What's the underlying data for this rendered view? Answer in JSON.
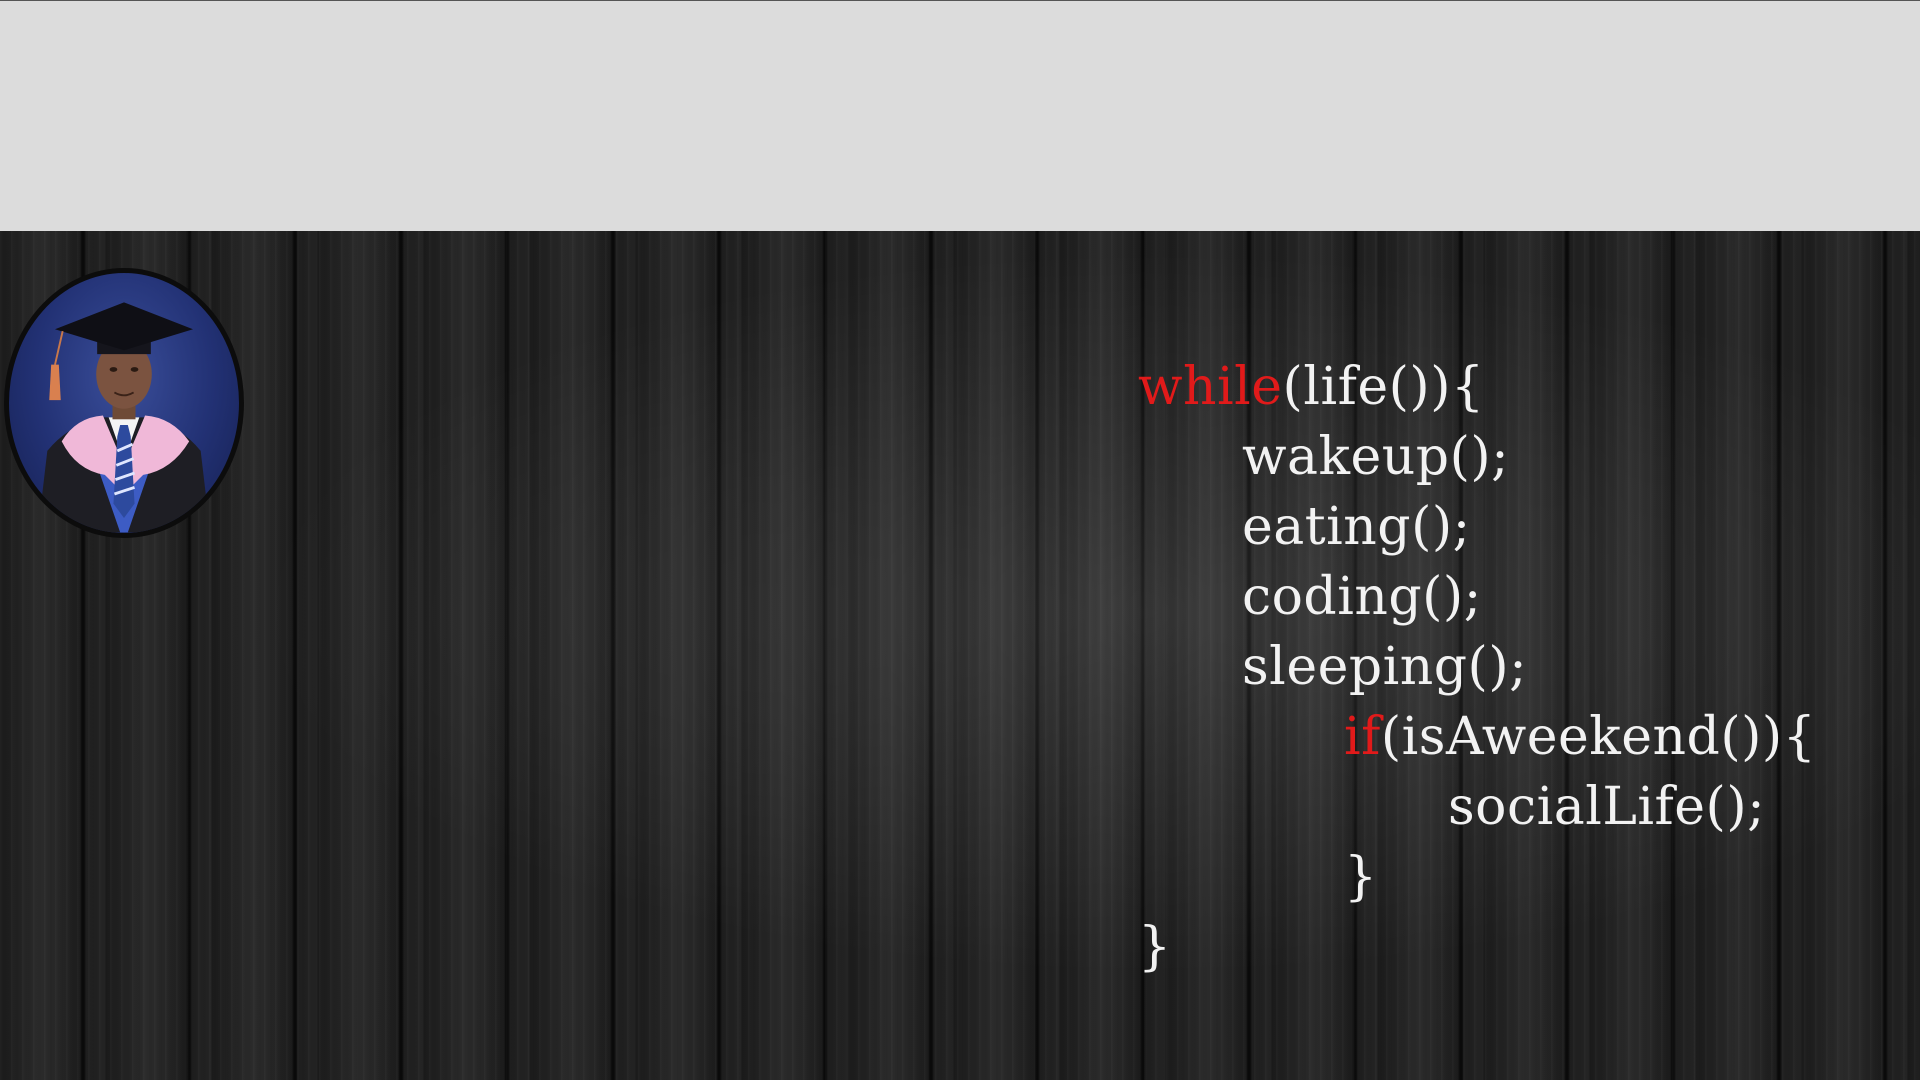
{
  "colors": {
    "top_band": "#dcdcdc",
    "wood": "#1d1d1d",
    "keyword": "#e11a1a",
    "code_text": "#f2f2f2"
  },
  "avatar": {
    "icon": "graduate-portrait"
  },
  "code": {
    "line1": {
      "keyword": "while",
      "rest": "(life()){"
    },
    "line2": "wakeup();",
    "line3": "eating();",
    "line4": "coding();",
    "line5": "sleeping();",
    "line6": {
      "keyword": "if",
      "rest": "(isAweekend()){"
    },
    "line7": "socialLife();",
    "line8": "}",
    "line9": "}"
  }
}
